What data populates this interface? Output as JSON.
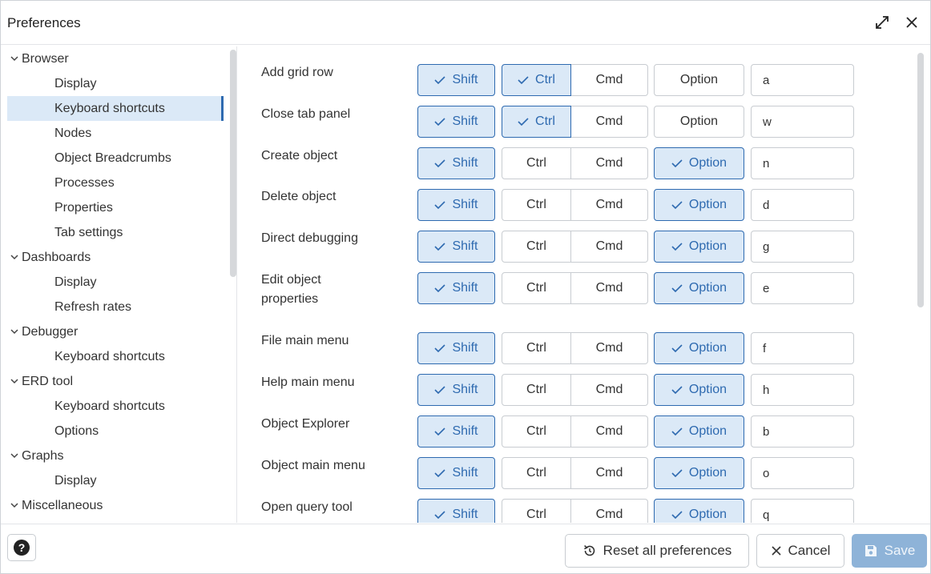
{
  "window": {
    "title": "Preferences"
  },
  "sidebar": {
    "groups": [
      {
        "label": "Browser",
        "items": [
          "Display",
          "Keyboard shortcuts",
          "Nodes",
          "Object Breadcrumbs",
          "Processes",
          "Properties",
          "Tab settings"
        ]
      },
      {
        "label": "Dashboards",
        "items": [
          "Display",
          "Refresh rates"
        ]
      },
      {
        "label": "Debugger",
        "items": [
          "Keyboard shortcuts"
        ]
      },
      {
        "label": "ERD tool",
        "items": [
          "Keyboard shortcuts",
          "Options"
        ]
      },
      {
        "label": "Graphs",
        "items": [
          "Display"
        ]
      },
      {
        "label": "Miscellaneous",
        "items": []
      }
    ],
    "selected": "Browser / Keyboard shortcuts"
  },
  "key_labels": {
    "shift": "Shift",
    "ctrl": "Ctrl",
    "cmd": "Cmd",
    "option": "Option"
  },
  "shortcuts": [
    {
      "label": "Add grid row",
      "shift": true,
      "ctrl": true,
      "cmd": false,
      "option": false,
      "key": "a"
    },
    {
      "label": "Close tab panel",
      "shift": true,
      "ctrl": true,
      "cmd": false,
      "option": false,
      "key": "w"
    },
    {
      "label": "Create object",
      "shift": true,
      "ctrl": false,
      "cmd": false,
      "option": true,
      "key": "n"
    },
    {
      "label": "Delete object",
      "shift": true,
      "ctrl": false,
      "cmd": false,
      "option": true,
      "key": "d"
    },
    {
      "label": "Direct debugging",
      "shift": true,
      "ctrl": false,
      "cmd": false,
      "option": true,
      "key": "g"
    },
    {
      "label": "Edit object properties",
      "shift": true,
      "ctrl": false,
      "cmd": false,
      "option": true,
      "key": "e"
    },
    {
      "label": "File main menu",
      "shift": true,
      "ctrl": false,
      "cmd": false,
      "option": true,
      "key": "f"
    },
    {
      "label": "Help main menu",
      "shift": true,
      "ctrl": false,
      "cmd": false,
      "option": true,
      "key": "h"
    },
    {
      "label": "Object Explorer",
      "shift": true,
      "ctrl": false,
      "cmd": false,
      "option": true,
      "key": "b"
    },
    {
      "label": "Object main menu",
      "shift": true,
      "ctrl": false,
      "cmd": false,
      "option": true,
      "key": "o"
    },
    {
      "label": "Open query tool",
      "shift": true,
      "ctrl": false,
      "cmd": false,
      "option": true,
      "key": "q"
    }
  ],
  "footer": {
    "reset_label": "Reset all preferences",
    "cancel_label": "Cancel",
    "save_label": "Save"
  },
  "icons": {
    "expand": "expand-icon",
    "close": "close-icon",
    "help": "help-icon",
    "reset": "reset-icon",
    "cancel": "close-icon",
    "save": "floppy-disk-icon",
    "check": "check-icon",
    "chevron": "chevron-down-icon"
  },
  "colors": {
    "accent": "#2e6ab0",
    "selected_bg": "#dbe9f7",
    "save_bg": "#8eb3d8"
  }
}
